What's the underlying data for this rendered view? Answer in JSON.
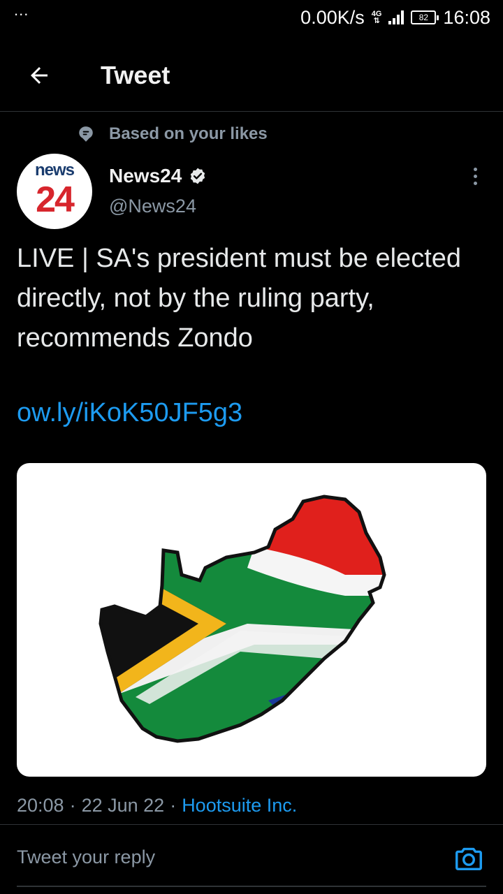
{
  "status_bar": {
    "dots": "...",
    "network_speed": "0.00K/s",
    "network_type": "4G",
    "battery": "82",
    "time": "16:08"
  },
  "header": {
    "title": "Tweet"
  },
  "context": {
    "label": "Based on your likes"
  },
  "tweet": {
    "avatar_top": "news",
    "avatar_number": "24",
    "author_name": "News24",
    "author_handle": "@News24",
    "text": "LIVE | SA's president must be elected directly, not by the ruling party, recommends Zondo",
    "link": "ow.ly/iKoK50JF5g3",
    "time": "20:08",
    "date": "22 Jun 22",
    "separator": "·",
    "source": "Hootsuite Inc."
  },
  "reply": {
    "placeholder": "Tweet your reply"
  },
  "colors": {
    "accent": "#1d9bf0",
    "background": "#000000",
    "muted": "#8b98a5"
  }
}
